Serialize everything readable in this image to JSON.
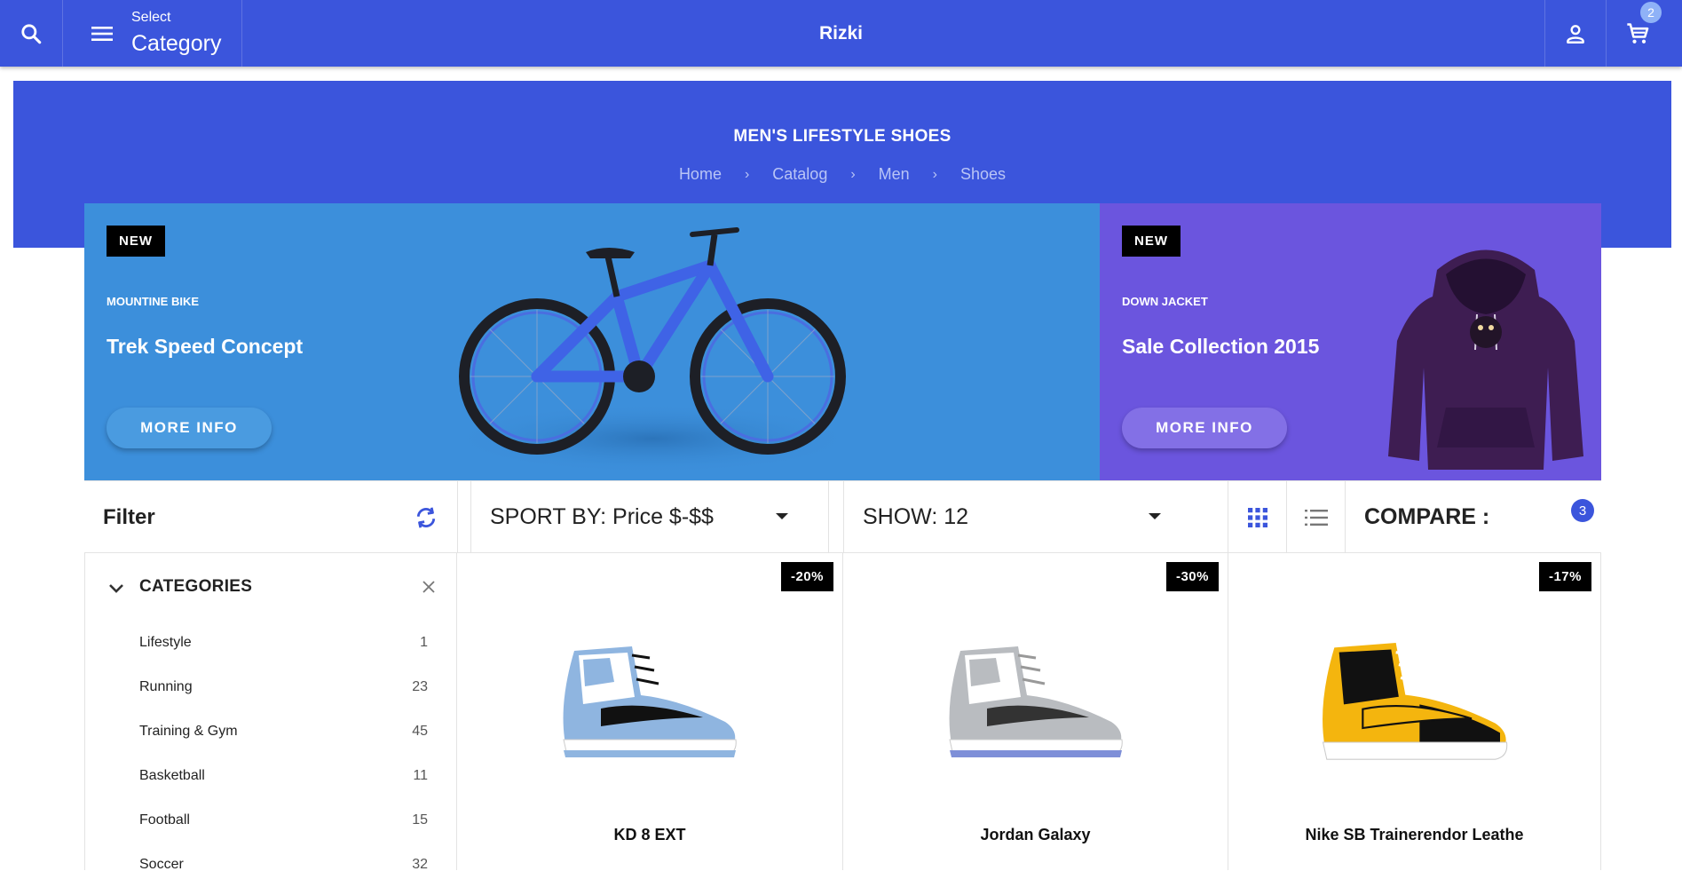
{
  "topbar": {
    "select_small": "Select",
    "select_big": "Category",
    "brand": "Rizki",
    "cart_count": "2",
    "bg_color": "#3b55dc"
  },
  "hero": {
    "title": "MEN'S LIFESTYLE SHOES",
    "breadcrumb": [
      "Home",
      "Catalog",
      "Men",
      "Shoes"
    ]
  },
  "promos": [
    {
      "tag": "NEW",
      "kicker": "MOUNTINE BIKE",
      "headline": "Trek Speed Concept",
      "button": "MORE INFO",
      "image": "mountain-bike",
      "color": "#3c8fdb"
    },
    {
      "tag": "NEW",
      "kicker": "DOWN JACKET",
      "headline": "Sale Collection 2015",
      "button": "MORE INFO",
      "image": "purple-hoodie",
      "color": "#6b55de"
    }
  ],
  "toolbar": {
    "filter_title": "Filter",
    "sort_label": "SPORT BY: Price $-$$",
    "show_label": "SHOW: 12",
    "compare_label": "COMPARE :",
    "compare_count": "3"
  },
  "categories": {
    "title": "CATEGORIES",
    "items": [
      {
        "label": "Lifestyle",
        "count": "1"
      },
      {
        "label": "Running",
        "count": "23"
      },
      {
        "label": "Training & Gym",
        "count": "45"
      },
      {
        "label": "Basketball",
        "count": "11"
      },
      {
        "label": "Football",
        "count": "15"
      },
      {
        "label": "Soccer",
        "count": "32"
      }
    ]
  },
  "products": [
    {
      "name": "KD 8 EXT",
      "discount": "-20%",
      "colors": [
        "#8fb5e0",
        "#ffffff",
        "#111111"
      ]
    },
    {
      "name": "Jordan Galaxy",
      "discount": "-30%",
      "colors": [
        "#b9bcc0",
        "#ffffff",
        "#333333"
      ]
    },
    {
      "name": "Nike SB Trainerendor Leathe",
      "discount": "-17%",
      "colors": [
        "#f4b50e",
        "#111111",
        "#ffffff"
      ]
    }
  ]
}
